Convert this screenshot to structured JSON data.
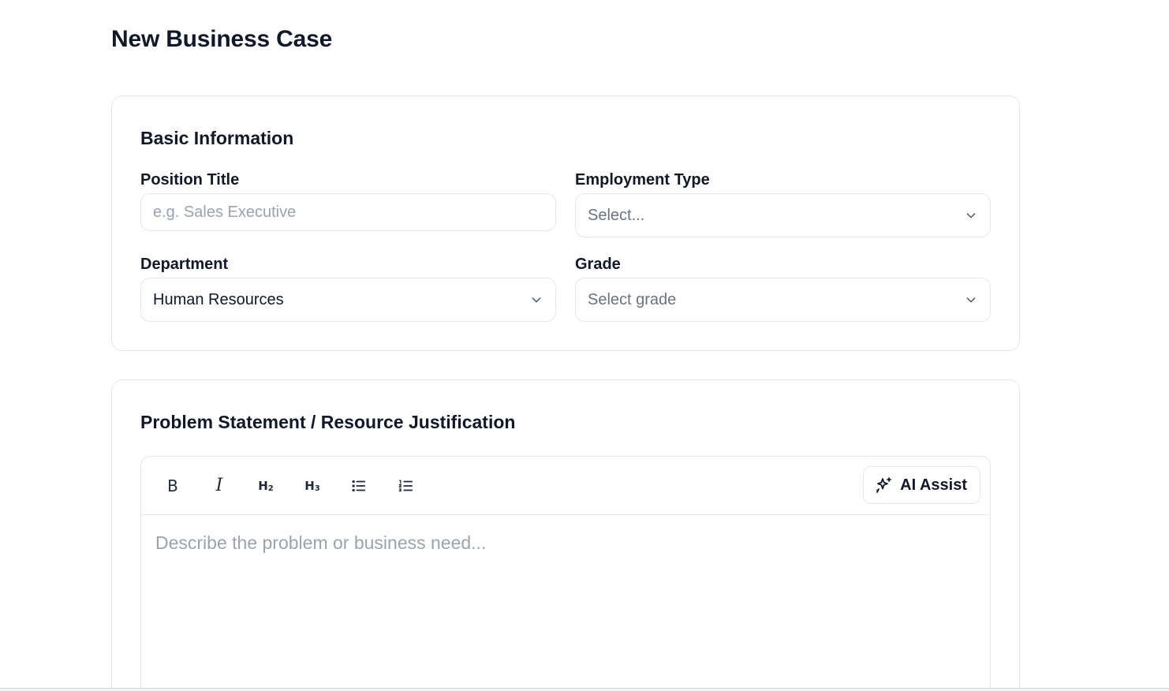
{
  "page": {
    "title": "New Business Case"
  },
  "basic_info": {
    "heading": "Basic Information",
    "position_title": {
      "label": "Position Title",
      "value": "",
      "placeholder": "e.g. Sales Executive"
    },
    "employment_type": {
      "label": "Employment Type",
      "selected": "Select..."
    },
    "department": {
      "label": "Department",
      "selected": "Human Resources"
    },
    "grade": {
      "label": "Grade",
      "selected": "Select grade"
    }
  },
  "problem": {
    "heading": "Problem Statement / Resource Justification",
    "toolbar": {
      "bold": "B",
      "italic": "I",
      "h2": "H",
      "h2_sub": "2",
      "h3": "H",
      "h3_sub": "3",
      "bullet_icon": "bullet-list-icon",
      "ordered_icon": "ordered-list-icon",
      "ai_icon": "sparkles-icon",
      "ai_label": "AI Assist"
    },
    "editor": {
      "placeholder": "Describe the problem or business need..."
    }
  },
  "colors": {
    "text": "#111827",
    "placeholder": "#9ca3af",
    "border": "#e5e7eb"
  }
}
